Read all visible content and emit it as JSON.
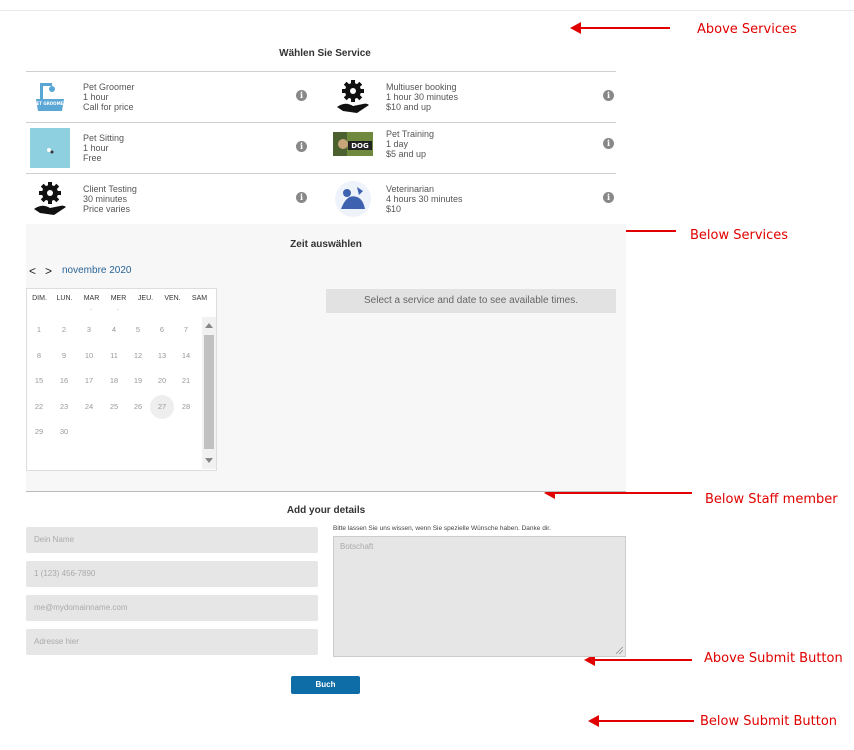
{
  "services_title": "Wählen Sie Service",
  "services": [
    {
      "name": "Pet Groomer",
      "duration": "1 hour",
      "price": "Call for price",
      "icon": "pet-groomer-image"
    },
    {
      "name": "Multiuser booking",
      "duration": "1 hour 30 minutes",
      "price": "$10 and up",
      "icon": "gear-hand-icon"
    },
    {
      "name": "Pet Sitting",
      "duration": "1 hour",
      "price": "Free",
      "icon": "pet-sitting-image"
    },
    {
      "name": "Pet Training",
      "duration": "1 day",
      "price": "$5 and up",
      "icon": "pet-training-image"
    },
    {
      "name": "Client Testing",
      "duration": "30 minutes",
      "price": "Price varies",
      "icon": "gear-hand-icon"
    },
    {
      "name": "Veterinarian",
      "duration": "4 hours 30 minutes",
      "price": "$10",
      "icon": "veterinarian-image"
    }
  ],
  "groomer_thumb_text": "PET GROOMER",
  "training_thumb_text": "DOG",
  "info_glyph": "i",
  "time": {
    "title": "Zeit auswählen",
    "prev": "<",
    "next": ">",
    "month": "novembre 2020",
    "weekdays": [
      "DIM.",
      "LUN.",
      "MAR",
      "MER",
      "JEU.",
      "VEN.",
      "SAM"
    ],
    "weekday_dots": [
      ".",
      "."
    ],
    "days": [
      [
        1,
        2,
        3,
        4,
        5,
        6,
        7
      ],
      [
        8,
        9,
        10,
        11,
        12,
        13,
        14
      ],
      [
        15,
        16,
        17,
        18,
        19,
        20,
        21
      ],
      [
        22,
        23,
        24,
        25,
        26,
        27,
        28
      ],
      [
        29,
        30
      ]
    ],
    "selected_day": 27,
    "availability_text": "Select a service and date to see available times."
  },
  "details": {
    "title": "Add your details",
    "name_placeholder": "Dein Name",
    "phone_placeholder": "1 (123) 456-7890",
    "email_placeholder": "me@mydomainname.com",
    "address_placeholder": "Adresse hier",
    "message_hint": "Bitte lassen Sie uns wissen, wenn Sie spezielle Wünsche haben. Danke dir.",
    "message_placeholder": "Botschaft",
    "submit_label": "Buch"
  },
  "annotations": {
    "above_services": "Above Services",
    "below_services": "Below Services",
    "below_staff": "Below Staff member",
    "above_submit": "Above Submit Button",
    "below_submit": "Below Submit Button",
    "color": "#e00000"
  },
  "accent_color": "#0e6da7"
}
